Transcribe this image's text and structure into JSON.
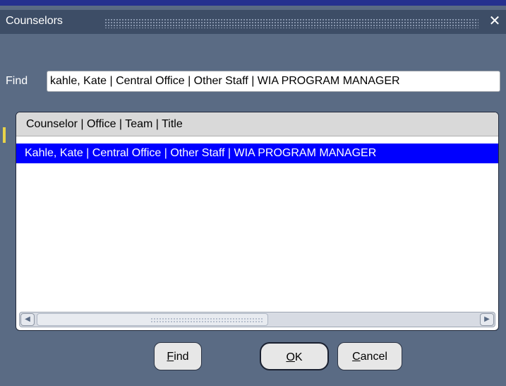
{
  "window": {
    "title": "Counselors",
    "close_glyph": "✕"
  },
  "find": {
    "label": "Find",
    "value": "kahle, Kate | Central Office | Other Staff | WIA PROGRAM MANAGER"
  },
  "list": {
    "header": "Counselor | Office | Team | Title",
    "rows": [
      {
        "text": "Kahle, Kate | Central Office | Other Staff | WIA PROGRAM MANAGER",
        "selected": true
      }
    ]
  },
  "scrollbar": {
    "left_icon": "arrow-left-icon",
    "right_icon": "arrow-right-icon",
    "left_glyph": "◀",
    "right_glyph": "▶"
  },
  "buttons": {
    "find": "Find",
    "ok": "OK",
    "cancel": "Cancel"
  },
  "colors": {
    "window_bg": "#5a6b84",
    "titlebar_bg": "#3d4d66",
    "selection": "#0000ff"
  }
}
